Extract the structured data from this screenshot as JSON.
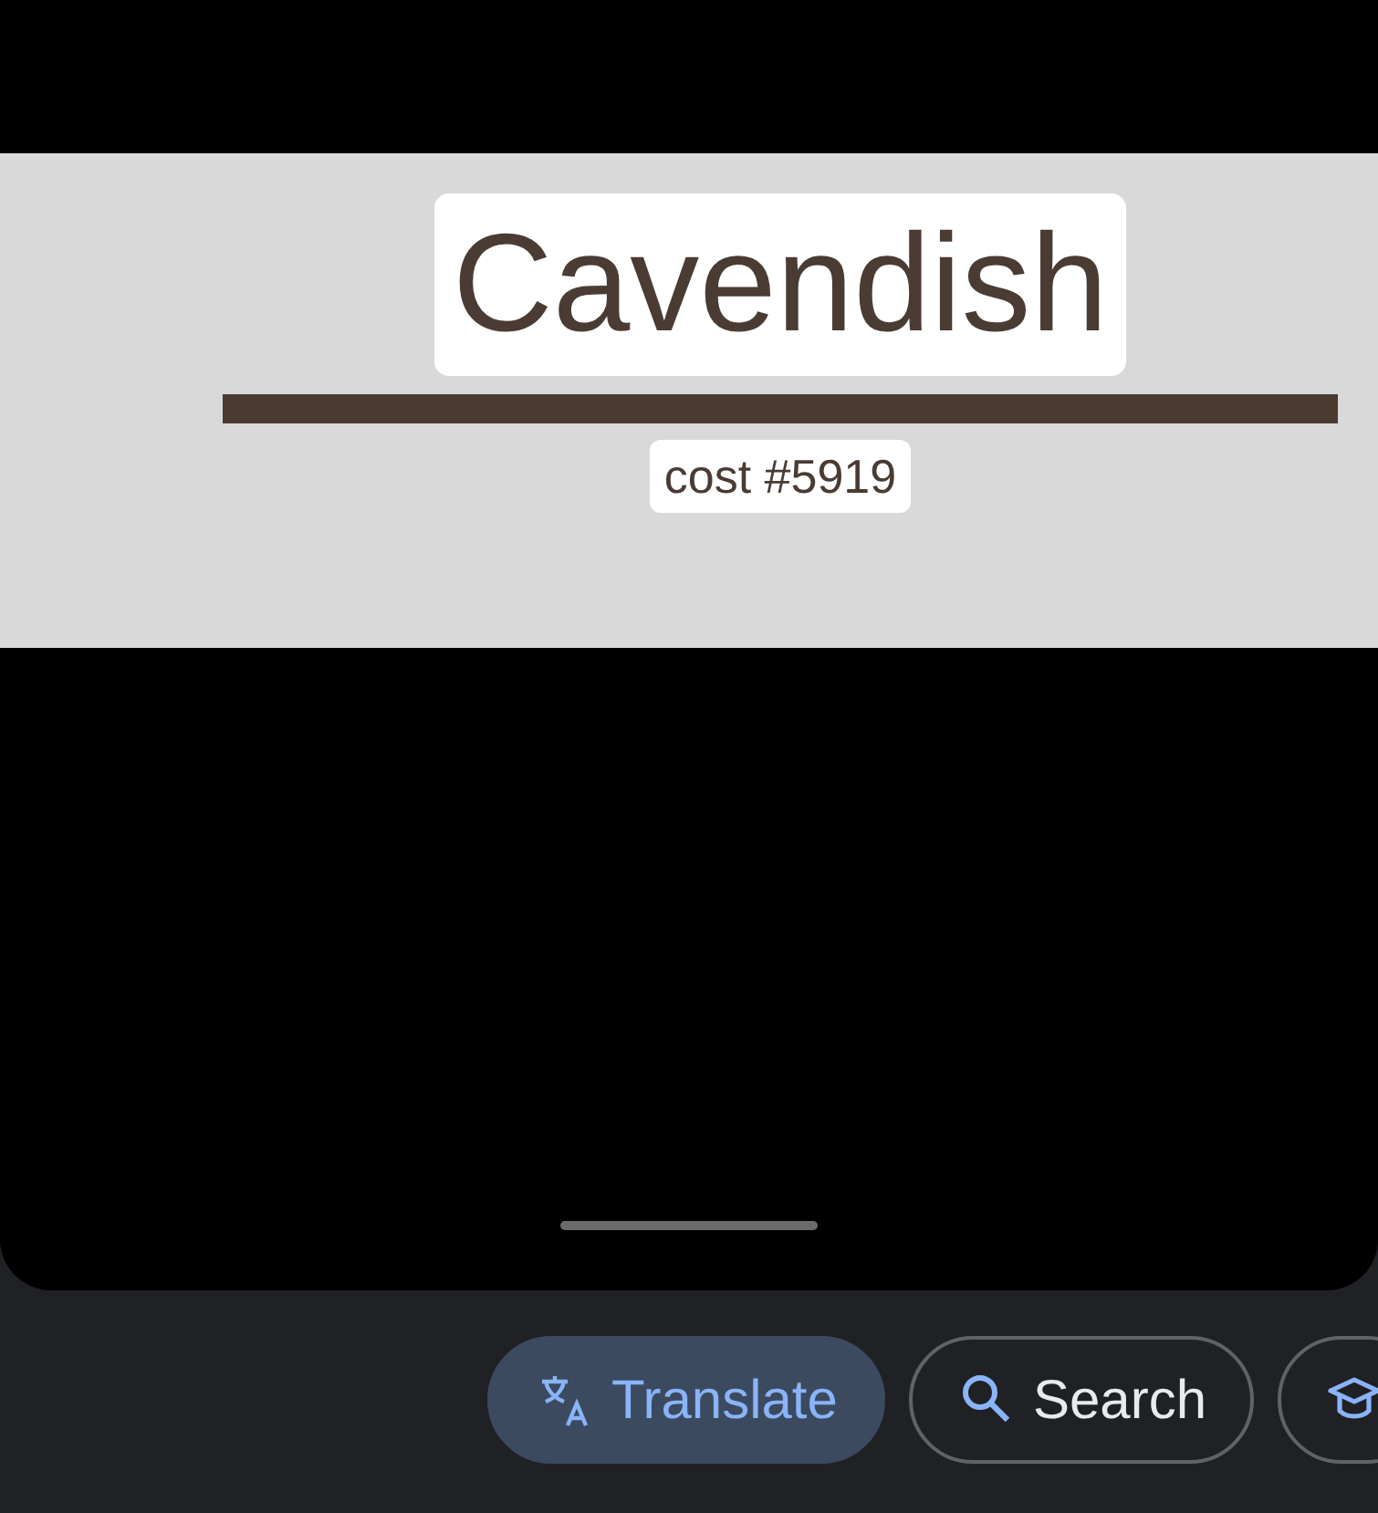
{
  "viewer": {
    "text_blocks": [
      {
        "kind": "title",
        "text": "Cavendish"
      },
      {
        "kind": "caption",
        "text": "cost #5919"
      }
    ]
  },
  "chips": [
    {
      "kind": "translate",
      "label": "Translate",
      "selected": true
    },
    {
      "kind": "search",
      "label": "Search",
      "selected": false
    },
    {
      "kind": "cap",
      "selected": false
    }
  ]
}
